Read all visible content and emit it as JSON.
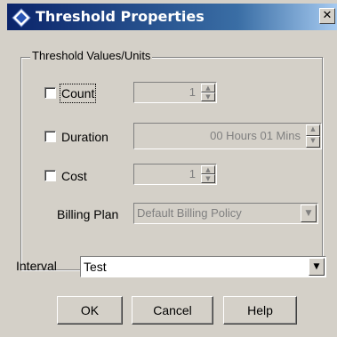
{
  "window": {
    "title": "Threshold Properties",
    "close_glyph": "✕"
  },
  "group": {
    "label": "Threshold Values/Units",
    "count": {
      "label": "Count",
      "checked": false,
      "value": "1"
    },
    "duration": {
      "label": "Duration",
      "checked": false,
      "value": "00 Hours 01 Mins"
    },
    "cost": {
      "label": "Cost",
      "checked": false,
      "value": "1"
    },
    "billing_plan": {
      "label": "Billing Plan",
      "value": "Default Billing Policy"
    }
  },
  "interval": {
    "label": "Interval",
    "value": "Test"
  },
  "buttons": {
    "ok": "OK",
    "cancel": "Cancel",
    "help": "Help"
  },
  "icons": {
    "title": "diamond-app-icon",
    "up": "▲",
    "down": "▼",
    "dropdown": "▼"
  }
}
